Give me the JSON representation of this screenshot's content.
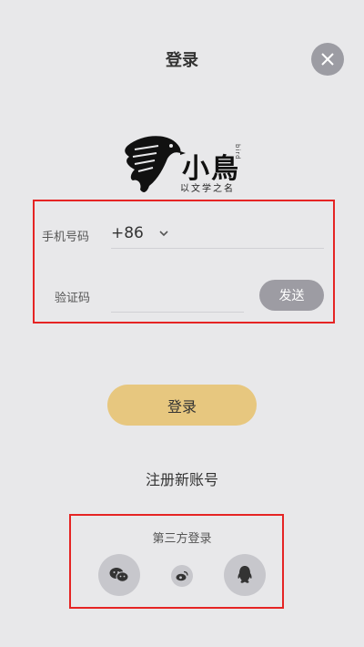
{
  "header": {
    "title": "登录"
  },
  "logo": {
    "chinese": "小鳥",
    "tagline": "以文学之名",
    "vertical_text": "bird"
  },
  "form": {
    "phone_label": "手机号码",
    "country_code": "+86",
    "phone_value": "",
    "code_label": "验证码",
    "code_value": "",
    "send_label": "发送"
  },
  "actions": {
    "login_label": "登录",
    "register_label": "注册新账号"
  },
  "third_party": {
    "title": "第三方登录",
    "options": [
      "wechat-icon",
      "weibo-icon",
      "qq-icon"
    ]
  },
  "colors": {
    "background": "#e8e8ea",
    "accent": "#e7c77f",
    "button_gray": "#9d9ca3",
    "highlight_red": "#e52424"
  }
}
